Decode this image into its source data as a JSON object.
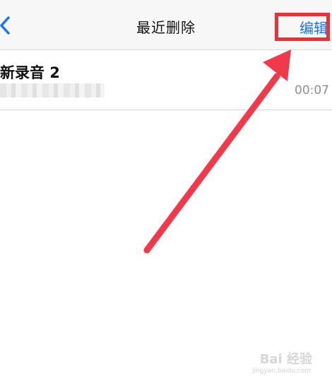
{
  "navbar": {
    "title": "最近删除",
    "edit_label": "编辑"
  },
  "recordings": [
    {
      "title": "新录音 2",
      "duration": "00:07"
    }
  ],
  "annotation": {
    "highlight_color": "#e8323a",
    "arrow_color": "#f03a4c"
  },
  "watermark": {
    "brand": "Bai 经验",
    "url": "jingyan.baidu.com"
  }
}
